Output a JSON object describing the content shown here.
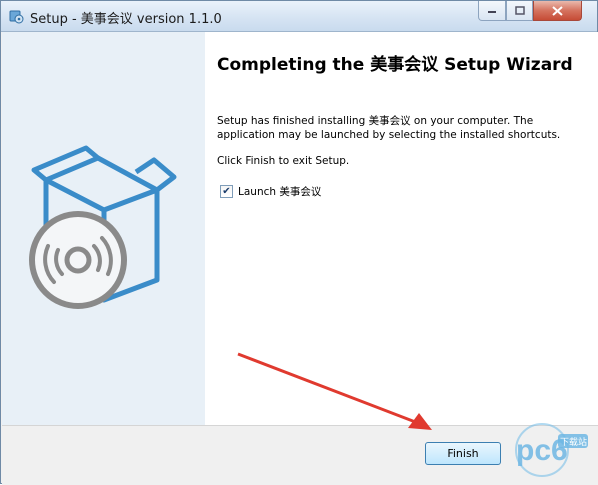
{
  "window": {
    "title": "Setup - 美事会议 version 1.1.0",
    "icons": {
      "app": "setup-app-icon",
      "minimize": "minimize-icon",
      "maximize": "maximize-icon",
      "close": "close-icon"
    }
  },
  "sidebar": {
    "illustration": "software-box-with-disc-icon"
  },
  "main": {
    "heading": "Completing the 美事会议 Setup Wizard",
    "paragraph1": "Setup has finished installing 美事会议 on your computer. The application may be launched by selecting the installed shortcuts.",
    "paragraph2": "Click Finish to exit Setup.",
    "launch_checkbox": {
      "label": "Launch 美事会议",
      "checked": true
    }
  },
  "footer": {
    "finish_label": "Finish"
  },
  "watermark": {
    "text": "pc6",
    "subtext": "下载站"
  },
  "colors": {
    "accent": "#3a8cc9",
    "arrow": "#e03a2f"
  }
}
